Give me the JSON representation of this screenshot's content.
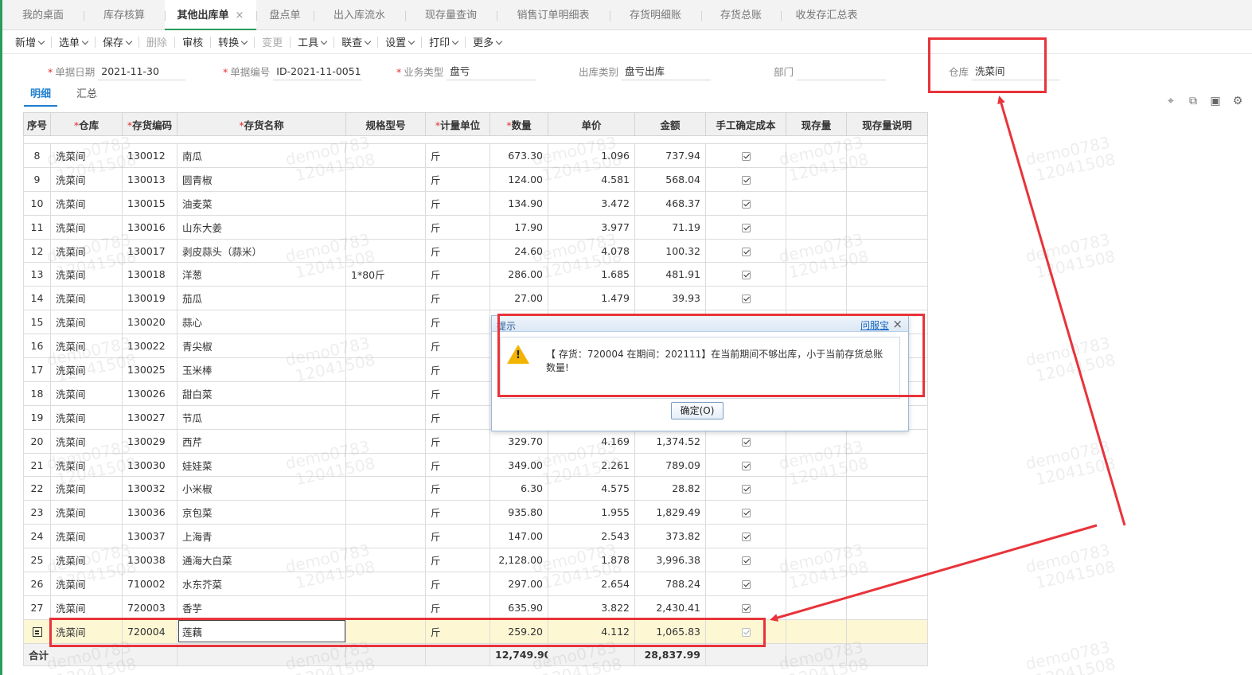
{
  "tabs": [
    {
      "label": "我的桌面",
      "w": 102
    },
    {
      "label": "库存核算",
      "w": 102
    },
    {
      "label": "其他出库单",
      "w": 115,
      "active": true
    },
    {
      "label": "盘点单",
      "w": 72
    },
    {
      "label": "出入库流水",
      "w": 115
    },
    {
      "label": "现存量查询",
      "w": 115
    },
    {
      "label": "销售订单明细表",
      "w": 142
    },
    {
      "label": "存货明细账",
      "w": 115
    },
    {
      "label": "存货总账",
      "w": 100
    },
    {
      "label": "收发存汇总表",
      "w": 115
    }
  ],
  "toolbar": {
    "new": "新增",
    "select": "选单",
    "save": "保存",
    "delete": "删除",
    "audit": "审核",
    "convert": "转换",
    "change": "变更",
    "tools": "工具",
    "linked": "联查",
    "settings": "设置",
    "print": "打印",
    "more": "更多"
  },
  "form": {
    "date_label": "单据日期",
    "date_value": "2021-11-30",
    "no_label": "单据编号",
    "no_value": "ID-2021-11-0051",
    "biz_label": "业务类型",
    "biz_value": "盘亏",
    "out_label": "出库类别",
    "out_value": "盘亏出库",
    "dept_label": "部门",
    "dept_value": "",
    "wh_label": "仓库",
    "wh_value": "洗菜间"
  },
  "subtabs": {
    "detail": "明细",
    "summary": "汇总"
  },
  "grid": {
    "headers": [
      "序号",
      "仓库",
      "存货编码",
      "存货名称",
      "规格型号",
      "计量单位",
      "数量",
      "单价",
      "金额",
      "手工确定成本",
      "现存量",
      "现存量说明"
    ],
    "rows": [
      {
        "no": "8",
        "wh": "洗菜间",
        "code": "130012",
        "name": "南瓜",
        "spec": "",
        "unit": "斤",
        "qty": "673.30",
        "price": "1.096",
        "amt": "737.94",
        "chk": true
      },
      {
        "no": "9",
        "wh": "洗菜间",
        "code": "130013",
        "name": "圆青椒",
        "spec": "",
        "unit": "斤",
        "qty": "124.00",
        "price": "4.581",
        "amt": "568.04",
        "chk": true
      },
      {
        "no": "10",
        "wh": "洗菜间",
        "code": "130015",
        "name": "油麦菜",
        "spec": "",
        "unit": "斤",
        "qty": "134.90",
        "price": "3.472",
        "amt": "468.37",
        "chk": true
      },
      {
        "no": "11",
        "wh": "洗菜间",
        "code": "130016",
        "name": "山东大姜",
        "spec": "",
        "unit": "斤",
        "qty": "17.90",
        "price": "3.977",
        "amt": "71.19",
        "chk": true
      },
      {
        "no": "12",
        "wh": "洗菜间",
        "code": "130017",
        "name": "剥皮蒜头（蒜米）",
        "spec": "",
        "unit": "斤",
        "qty": "24.60",
        "price": "4.078",
        "amt": "100.32",
        "chk": true
      },
      {
        "no": "13",
        "wh": "洗菜间",
        "code": "130018",
        "name": "洋葱",
        "spec": "1*80斤",
        "unit": "斤",
        "qty": "286.00",
        "price": "1.685",
        "amt": "481.91",
        "chk": true
      },
      {
        "no": "14",
        "wh": "洗菜间",
        "code": "130019",
        "name": "茄瓜",
        "spec": "",
        "unit": "斤",
        "qty": "27.00",
        "price": "1.479",
        "amt": "39.93",
        "chk": true
      },
      {
        "no": "15",
        "wh": "洗菜间",
        "code": "130020",
        "name": "蒜心",
        "spec": "",
        "unit": "斤",
        "qty": "",
        "price": "",
        "amt": "",
        "chk": false
      },
      {
        "no": "16",
        "wh": "洗菜间",
        "code": "130022",
        "name": "青尖椒",
        "spec": "",
        "unit": "斤",
        "qty": "",
        "price": "",
        "amt": "",
        "chk": false
      },
      {
        "no": "17",
        "wh": "洗菜间",
        "code": "130025",
        "name": "玉米棒",
        "spec": "",
        "unit": "斤",
        "qty": "",
        "price": "",
        "amt": "",
        "chk": false
      },
      {
        "no": "18",
        "wh": "洗菜间",
        "code": "130026",
        "name": "甜白菜",
        "spec": "",
        "unit": "斤",
        "qty": "",
        "price": "",
        "amt": "",
        "chk": false
      },
      {
        "no": "19",
        "wh": "洗菜间",
        "code": "130027",
        "name": "节瓜",
        "spec": "",
        "unit": "斤",
        "qty": "",
        "price": "",
        "amt": "",
        "chk": false
      },
      {
        "no": "20",
        "wh": "洗菜间",
        "code": "130029",
        "name": "西芹",
        "spec": "",
        "unit": "斤",
        "qty": "329.70",
        "price": "4.169",
        "amt": "1,374.52",
        "chk": true
      },
      {
        "no": "21",
        "wh": "洗菜间",
        "code": "130030",
        "name": "娃娃菜",
        "spec": "",
        "unit": "斤",
        "qty": "349.00",
        "price": "2.261",
        "amt": "789.09",
        "chk": true
      },
      {
        "no": "22",
        "wh": "洗菜间",
        "code": "130032",
        "name": "小米椒",
        "spec": "",
        "unit": "斤",
        "qty": "6.30",
        "price": "4.575",
        "amt": "28.82",
        "chk": true
      },
      {
        "no": "23",
        "wh": "洗菜间",
        "code": "130036",
        "name": "京包菜",
        "spec": "",
        "unit": "斤",
        "qty": "935.80",
        "price": "1.955",
        "amt": "1,829.49",
        "chk": true
      },
      {
        "no": "24",
        "wh": "洗菜间",
        "code": "130037",
        "name": "上海青",
        "spec": "",
        "unit": "斤",
        "qty": "147.00",
        "price": "2.543",
        "amt": "373.82",
        "chk": true
      },
      {
        "no": "25",
        "wh": "洗菜间",
        "code": "130038",
        "name": "通海大白菜",
        "spec": "",
        "unit": "斤",
        "qty": "2,128.00",
        "price": "1.878",
        "amt": "3,996.38",
        "chk": true
      },
      {
        "no": "26",
        "wh": "洗菜间",
        "code": "710002",
        "name": "水东芥菜",
        "spec": "",
        "unit": "斤",
        "qty": "297.00",
        "price": "2.654",
        "amt": "788.24",
        "chk": true
      },
      {
        "no": "27",
        "wh": "洗菜间",
        "code": "720003",
        "name": "香芋",
        "spec": "",
        "unit": "斤",
        "qty": "635.90",
        "price": "3.822",
        "amt": "2,430.41",
        "chk": true
      }
    ],
    "selected_row": {
      "wh": "洗菜间",
      "code": "720004",
      "name": "莲藕",
      "spec": "",
      "unit": "斤",
      "qty": "259.20",
      "price": "4.112",
      "amt": "1,065.83"
    },
    "total": {
      "label": "合计",
      "qty": "12,749.90",
      "amt": "28,837.99"
    }
  },
  "dialog": {
    "title": "提示",
    "help": "问服宝",
    "message": "【 存货：720004 在期间：202111】在当前期间不够出库，小于当前存货总账数量!",
    "ok": "确定(O)"
  },
  "watermark": {
    "line1": "demo0783",
    "line2": "12041508"
  },
  "colors": {
    "accent_green": "#2a9d5c",
    "annotation_red": "#e8333a",
    "link_blue": "#1e7fd0"
  }
}
